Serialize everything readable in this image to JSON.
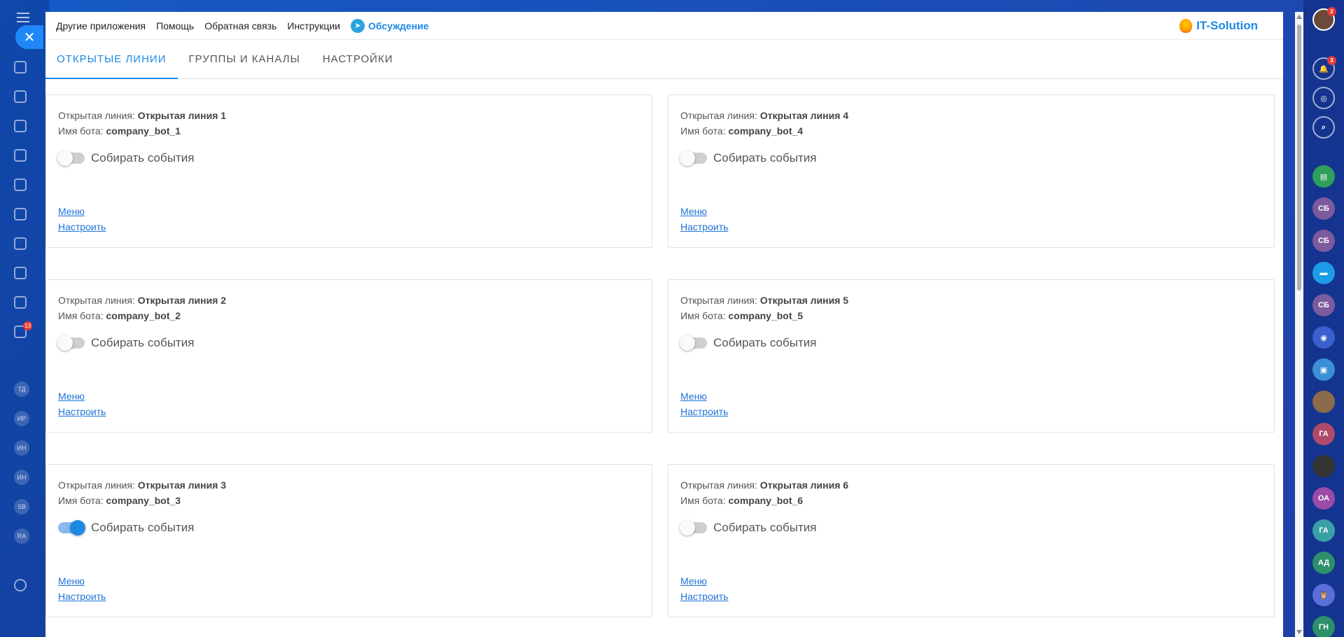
{
  "topbar": {
    "links": [
      "Другие приложения",
      "Помощь",
      "Обратная связь",
      "Инструкции"
    ],
    "telegram_label": "Обсуждение",
    "brand": "IT-Solution"
  },
  "tabs": [
    {
      "label": "ОТКРЫТЫЕ ЛИНИИ",
      "active": true
    },
    {
      "label": "ГРУППЫ И КАНАЛЫ",
      "active": false
    },
    {
      "label": "НАСТРОЙКИ",
      "active": false
    }
  ],
  "labels": {
    "line_prefix": "Открытая линия:",
    "bot_prefix": "Имя бота:",
    "toggle": "Собирать события",
    "menu": "Меню",
    "configure": "Настроить"
  },
  "cards": [
    {
      "line": "Открытая линия 1",
      "bot": "company_bot_1",
      "enabled": false
    },
    {
      "line": "Открытая линия 4",
      "bot": "company_bot_4",
      "enabled": false
    },
    {
      "line": "Открытая линия 2",
      "bot": "company_bot_2",
      "enabled": false
    },
    {
      "line": "Открытая линия 5",
      "bot": "company_bot_5",
      "enabled": false
    },
    {
      "line": "Открытая линия 3",
      "bot": "company_bot_3",
      "enabled": true
    },
    {
      "line": "Открытая линия 6",
      "bot": "company_bot_6",
      "enabled": false
    }
  ],
  "background_sidebar": {
    "badges": {
      "tasks": "13",
      "notifications": "3",
      "header_counter": "11",
      "header_counter_2": "2"
    },
    "avatars": [
      "ТД",
      "ИР",
      "ИН",
      "ИН",
      "SB",
      "RA"
    ],
    "right_avatars": [
      "СБ",
      "СБ",
      "СБ",
      "ГА",
      "ОА",
      "ГА",
      "АД",
      "ГН"
    ]
  },
  "colors": {
    "accent": "#1e88e5",
    "background": "#1a4fb8",
    "right_bar": "#14348f"
  }
}
